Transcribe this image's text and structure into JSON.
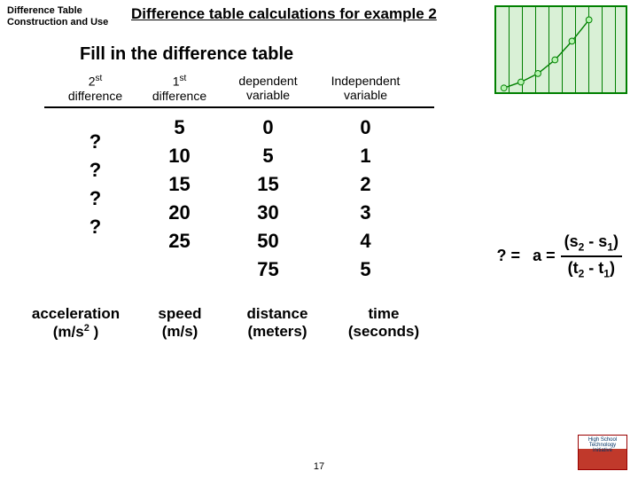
{
  "section_label_line1": "Difference Table",
  "section_label_line2": "Construction and Use",
  "title": "Difference table calculations for example 2",
  "subtitle": "Fill in the difference table",
  "headers": {
    "h1_top": "2",
    "h1_sup": "st",
    "h1_bot": "difference",
    "h2_top": "1",
    "h2_sup": "st",
    "h2_bot": "difference",
    "h3_top": "dependent",
    "h3_bot": "variable",
    "h4_top": "Independent",
    "h4_bot": "variable"
  },
  "col1": {
    "r1": "?",
    "r2": "?",
    "r3": "?",
    "r4": "?"
  },
  "col2": {
    "r1": "5",
    "r2": "10",
    "r3": "15",
    "r4": "20",
    "r5": "25"
  },
  "col3": {
    "r1": "0",
    "r2": "5",
    "r3": "15",
    "r4": "30",
    "r5": "50",
    "r6": "75"
  },
  "col4": {
    "r1": "0",
    "r2": "1",
    "r3": "2",
    "r4": "3",
    "r5": "4",
    "r6": "5"
  },
  "formula": {
    "lhs": "? =",
    "a_eq": "a =",
    "num_pref": "(s",
    "num_sub1": "2",
    "num_mid": " - s",
    "num_sub2": "1",
    "num_suf": ")",
    "den_pref": "(t",
    "den_sub1": "2",
    "den_mid": " - t",
    "den_sub2": "1",
    "den_suf": ")"
  },
  "units": {
    "u1_top": "acceleration",
    "u1_bot_pref": "(m/s",
    "u1_sup": "2",
    "u1_bot_suf": " )",
    "u2_top": "speed",
    "u2_bot": "(m/s)",
    "u3_top": "distance",
    "u3_bot": "(meters)",
    "u4_top": "time",
    "u4_bot": "(seconds)"
  },
  "page_num": "17",
  "logo_text": "High School Technology Initiative",
  "chart_data": {
    "type": "scatter",
    "x": [
      0,
      1,
      2,
      3,
      4,
      5
    ],
    "y": [
      0,
      5,
      15,
      30,
      50,
      75
    ],
    "xlabel": "",
    "ylabel": "",
    "title": ""
  }
}
